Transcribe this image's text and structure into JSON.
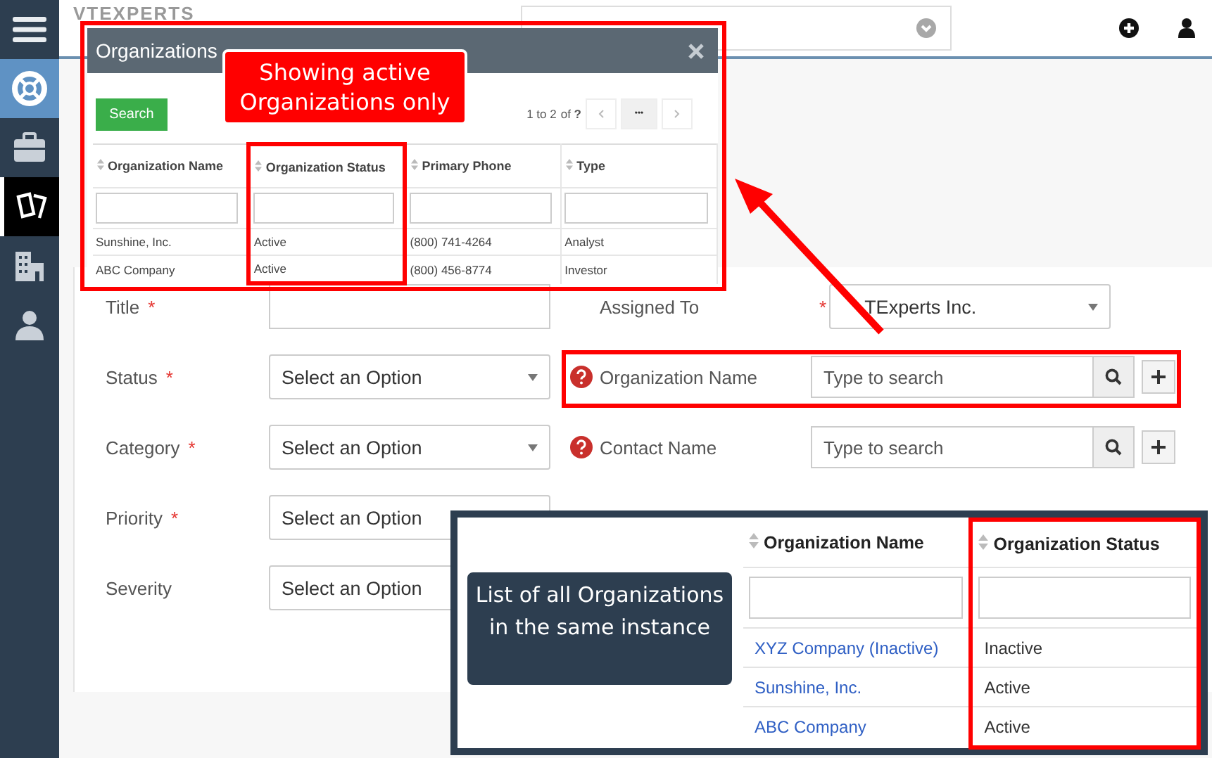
{
  "sidebar": {
    "items": [
      {
        "kind": "menu",
        "selected": false,
        "active": false
      },
      {
        "kind": "lifebuoy",
        "selected": true,
        "active": false
      },
      {
        "kind": "briefcase",
        "selected": false,
        "active": false
      },
      {
        "kind": "tickets",
        "selected": false,
        "active": true
      },
      {
        "kind": "building",
        "selected": false,
        "active": false
      },
      {
        "kind": "person",
        "selected": false,
        "active": false
      }
    ]
  },
  "header": {
    "logo": "VTEXPERTS"
  },
  "form": {
    "required_mark": "*",
    "left": [
      {
        "label": "Title",
        "required": true,
        "kind": "text"
      },
      {
        "label": "Status",
        "required": true,
        "kind": "select",
        "value": "Select an Option"
      },
      {
        "label": "Category",
        "required": true,
        "kind": "select",
        "value": "Select an Option"
      },
      {
        "label": "Priority",
        "required": true,
        "kind": "select",
        "value": "Select an Option"
      },
      {
        "label": "Severity",
        "required": false,
        "kind": "select",
        "value": "Select an Option"
      }
    ],
    "right": [
      {
        "label": "Assigned To",
        "required": true,
        "kind": "select",
        "value": "TExperts Inc.",
        "highlighted": false
      },
      {
        "label": "Organization Name",
        "required": false,
        "kind": "lookup",
        "placeholder": "Type to search",
        "highlighted": true
      },
      {
        "label": "Contact Name",
        "required": false,
        "kind": "lookup",
        "placeholder": "Type to search",
        "highlighted": false
      }
    ]
  },
  "popup": {
    "title": "Organizations",
    "search_button": "Search",
    "pagination": "1 to 2",
    "of": "of",
    "total": "?",
    "more": "•••",
    "columns": [
      {
        "label": "Organization Name",
        "highlighted": false
      },
      {
        "label": "Organization Status",
        "highlighted": true
      },
      {
        "label": "Primary Phone",
        "highlighted": false
      },
      {
        "label": "Type",
        "highlighted": false
      }
    ],
    "rows": [
      [
        "Sunshine, Inc.",
        "Active",
        "(800) 741-4264",
        "Analyst"
      ],
      [
        "ABC Company",
        "Active",
        "(800) 456-8774",
        "Investor"
      ]
    ],
    "callout": "Showing active Organizations only"
  },
  "full_list": {
    "columns": [
      {
        "label": "Organization Name",
        "highlighted": false
      },
      {
        "label": "Organization Status",
        "highlighted": true
      }
    ],
    "rows": [
      [
        "XYZ Company (Inactive)",
        "Inactive"
      ],
      [
        "Sunshine, Inc.",
        "Active"
      ],
      [
        "ABC Company",
        "Active"
      ]
    ],
    "callout": "List of all Organizations in the same instance"
  }
}
